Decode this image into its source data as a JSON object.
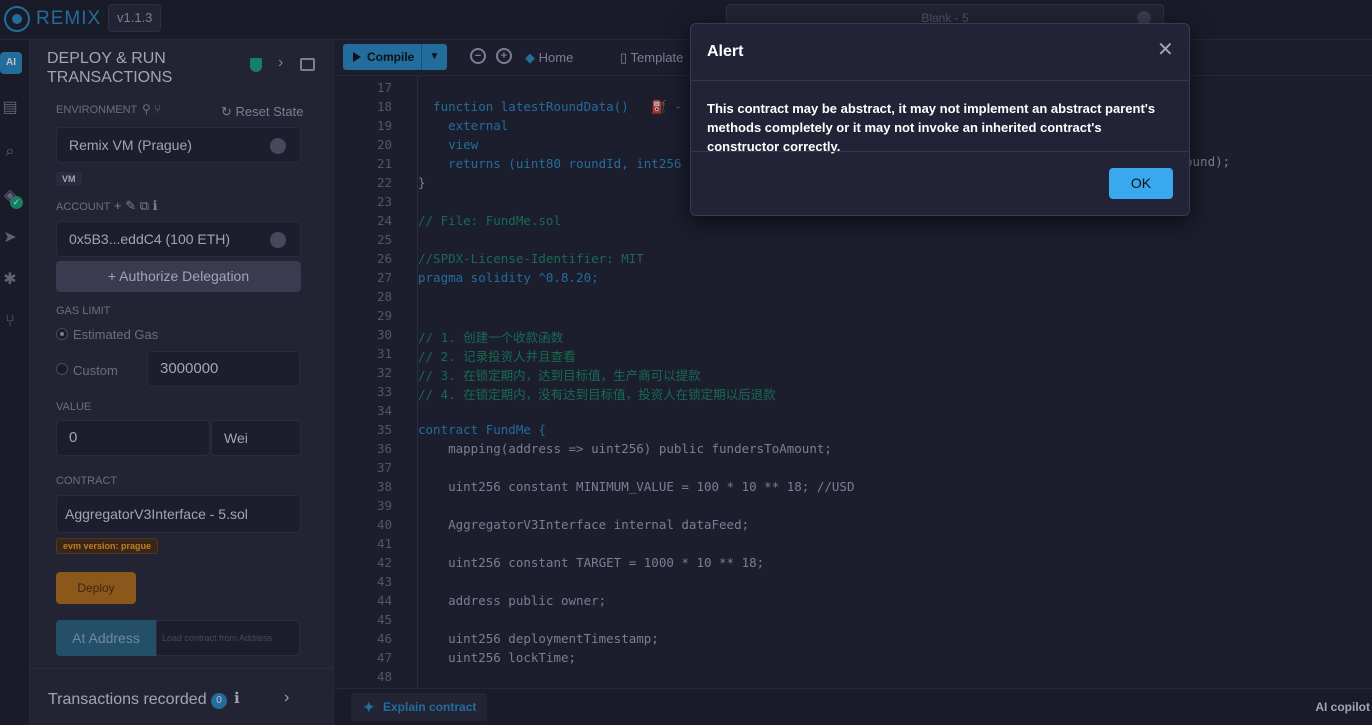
{
  "topbar": {
    "brand": "REMIX",
    "version": "v1.1.3",
    "workspace": "Blank - 5"
  },
  "sidebar_icons": [
    "ai-icon",
    "file-explorer-icon",
    "search-icon",
    "compiler-icon",
    "deploy-icon",
    "debugger-icon",
    "git-icon"
  ],
  "panel": {
    "title": "DEPLOY & RUN TRANSACTIONS",
    "environment_label": "ENVIRONMENT",
    "reset_state": "Reset State",
    "environment_value": "Remix VM (Prague)",
    "vm_badge": "VM",
    "account_label": "ACCOUNT",
    "account_value": "0x5B3...eddC4 (100 ETH)",
    "authorize": "+ Authorize Delegation",
    "gas_limit_label": "GAS LIMIT",
    "estimated_gas": "Estimated Gas",
    "custom": "Custom",
    "gas_value": "3000000",
    "value_label": "VALUE",
    "value_amount": "0",
    "value_unit": "Wei",
    "contract_label": "CONTRACT",
    "contract_value": "AggregatorV3Interface - 5.sol",
    "evm_badge": "evm version: prague",
    "deploy": "Deploy",
    "at_address": "At Address",
    "load_placeholder": "Load contract from Address",
    "tx_recorded": "Transactions recorded",
    "tx_count": "0"
  },
  "toolbar": {
    "compile": "Compile",
    "home": "Home",
    "template": "Template"
  },
  "code_lines": [
    {
      "n": "17",
      "t": ""
    },
    {
      "n": "18",
      "t": "  function latestRoundData()   ⛽ - "
    },
    {
      "n": "19",
      "t": "    external"
    },
    {
      "n": "20",
      "t": "    view"
    },
    {
      "n": "21",
      "t": "    returns (uint80 roundId, int256"
    },
    {
      "n": "22",
      "t": "}"
    },
    {
      "n": "23",
      "t": ""
    },
    {
      "n": "24",
      "t": "// File: FundMe.sol"
    },
    {
      "n": "25",
      "t": ""
    },
    {
      "n": "26",
      "t": "//SPDX-License-Identifier: MIT"
    },
    {
      "n": "27",
      "t": "pragma solidity ^0.8.20;"
    },
    {
      "n": "28",
      "t": ""
    },
    {
      "n": "29",
      "t": ""
    },
    {
      "n": "30",
      "t": "// 1. 创建一个收款函数"
    },
    {
      "n": "31",
      "t": "// 2. 记录投资人并且查看"
    },
    {
      "n": "32",
      "t": "// 3. 在锁定期内，达到目标值，生产商可以提款"
    },
    {
      "n": "33",
      "t": "// 4. 在锁定期内，没有达到目标值，投资人在锁定期以后退款"
    },
    {
      "n": "34",
      "t": ""
    },
    {
      "n": "35",
      "t": "contract FundMe {"
    },
    {
      "n": "36",
      "t": "    mapping(address => uint256) public fundersToAmount;"
    },
    {
      "n": "37",
      "t": ""
    },
    {
      "n": "38",
      "t": "    uint256 constant MINIMUM_VALUE = 100 * 10 ** 18; //USD"
    },
    {
      "n": "39",
      "t": ""
    },
    {
      "n": "40",
      "t": "    AggregatorV3Interface internal dataFeed;"
    },
    {
      "n": "41",
      "t": ""
    },
    {
      "n": "42",
      "t": "    uint256 constant TARGET = 1000 * 10 ** 18;"
    },
    {
      "n": "43",
      "t": ""
    },
    {
      "n": "44",
      "t": "    address public owner;"
    },
    {
      "n": "45",
      "t": ""
    },
    {
      "n": "46",
      "t": "    uint256 deploymentTimestamp;"
    },
    {
      "n": "47",
      "t": "    uint256 lockTime;"
    },
    {
      "n": "48",
      "t": ""
    }
  ],
  "code_tail_21": "ound);",
  "statusbar": {
    "explain": "Explain contract",
    "ai_copilot": "AI copilot"
  },
  "modal": {
    "title": "Alert",
    "message": "This contract may be abstract, it may not implement an abstract parent's methods completely or it may not invoke an inherited contract's constructor correctly.",
    "ok": "OK"
  }
}
